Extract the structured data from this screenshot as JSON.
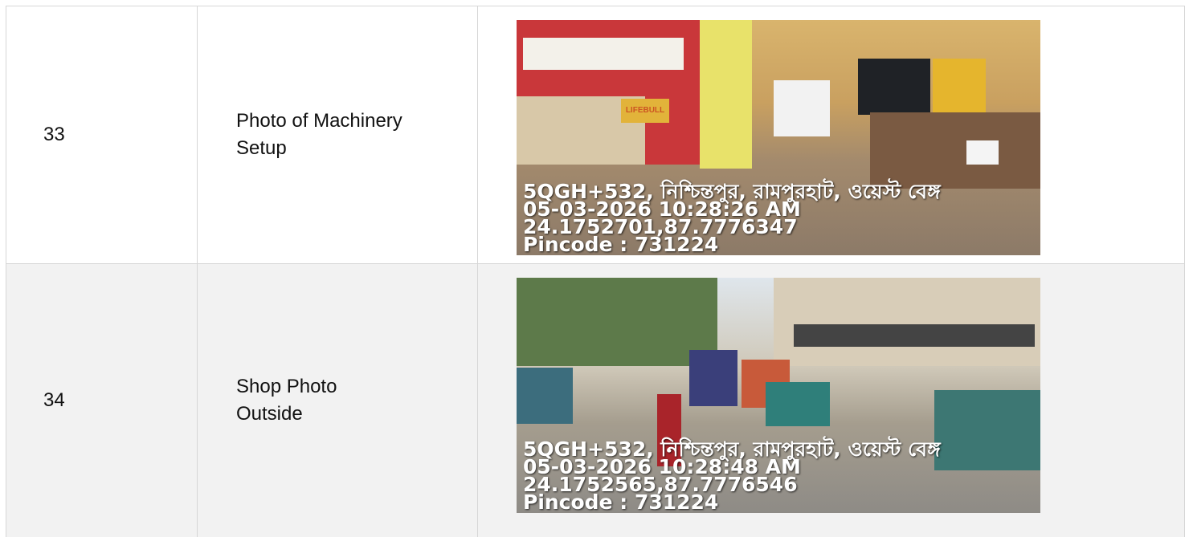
{
  "rows": [
    {
      "number": "33",
      "label_line1": "Photo of Machinery",
      "label_line2": "Setup",
      "overlay": [
        "5QGH+532, নিশ্চিন্তপুর, রামপুরহাট, ওয়েস্ট বেঙ্গ",
        "05-03-2026 10:28:26 AM",
        "24.1752701,87.7776347",
        "Pincode : 731224"
      ],
      "photo_signage": "LIFEBULL"
    },
    {
      "number": "34",
      "label_line1": "Shop Photo",
      "label_line2": "Outside",
      "overlay": [
        "5QGH+532, নিশ্চিন্তপুর, রামপুরহাট, ওয়েস্ট বেঙ্গ",
        "05-03-2026 10:28:48 AM",
        "24.1752565,87.7776546",
        "Pincode : 731224"
      ]
    }
  ]
}
